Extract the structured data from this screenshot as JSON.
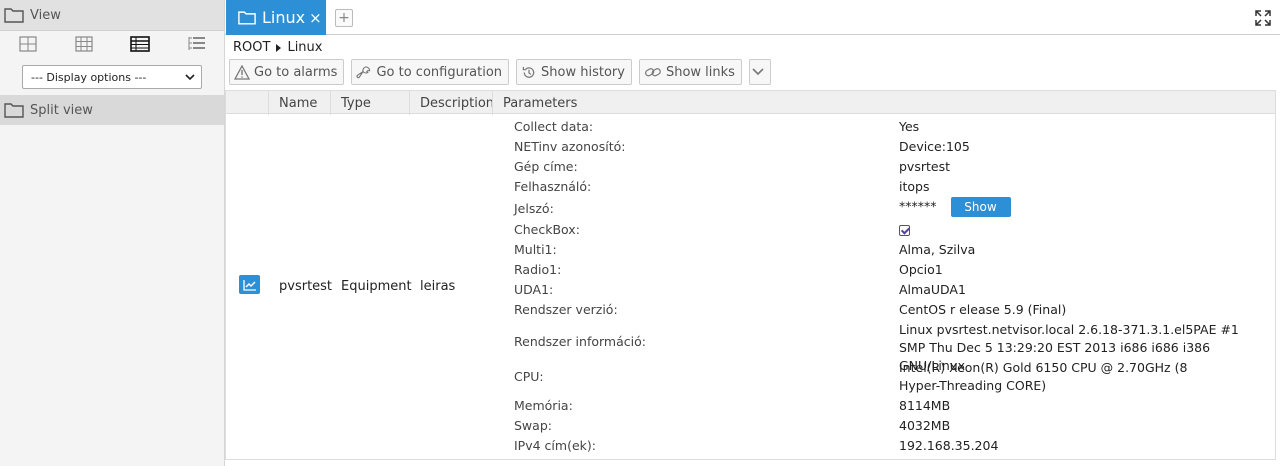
{
  "sidebar": {
    "view_label": "View",
    "display_options": "--- Display options ---",
    "split_view_label": "Split view"
  },
  "tabs": {
    "active_label": "Linux",
    "close": "×",
    "add": "+"
  },
  "breadcrumb": {
    "root": "ROOT",
    "current": "Linux"
  },
  "toolbar": {
    "alarms": "Go to alarms",
    "configuration": "Go to configuration",
    "history": "Show history",
    "links": "Show links"
  },
  "table": {
    "headers": {
      "name": "Name",
      "type": "Type",
      "description": "Description",
      "parameters": "Parameters"
    },
    "row": {
      "name": "pvsrtest",
      "type": "Equipment",
      "description": "leiras"
    }
  },
  "params": [
    {
      "name": "Collect data:",
      "value": "Yes"
    },
    {
      "name": "NETinv azonosító:",
      "value": "Device:105"
    },
    {
      "name": "Gép címe:",
      "value": "pvsrtest"
    },
    {
      "name": "Felhasználó:",
      "value": "itops"
    },
    {
      "name": "Jelszó:",
      "value": "******",
      "button": "Show"
    },
    {
      "name": "CheckBox:",
      "value": ""
    },
    {
      "name": "Multi1:",
      "value": "Alma, Szilva"
    },
    {
      "name": "Radio1:",
      "value": "Opcio1"
    },
    {
      "name": "UDA1:",
      "value": "AlmaUDA1"
    },
    {
      "name": "Rendszer verzió:",
      "value": "CentOS r elease 5.9 (Final)"
    },
    {
      "name": "Rendszer információ:",
      "value": "Linux pvsrtest.netvisor.local 2.6.18-371.3.1.el5PAE #1 SMP Thu Dec 5 13:29:20 EST 2013 i686 i686 i386 GNU/Linux"
    },
    {
      "name": "CPU:",
      "value": "Intel(R) Xeon(R) Gold 6150 CPU @ 2.70GHz (8 Hyper-Threading CORE)"
    },
    {
      "name": "Memória:",
      "value": "8114MB"
    },
    {
      "name": "Swap:",
      "value": "4032MB"
    },
    {
      "name": "IPv4 cím(ek):",
      "value": "192.168.35.204"
    }
  ],
  "colors": {
    "accent": "#2d8fd5",
    "sidebar_header": "#e1e1e1"
  }
}
